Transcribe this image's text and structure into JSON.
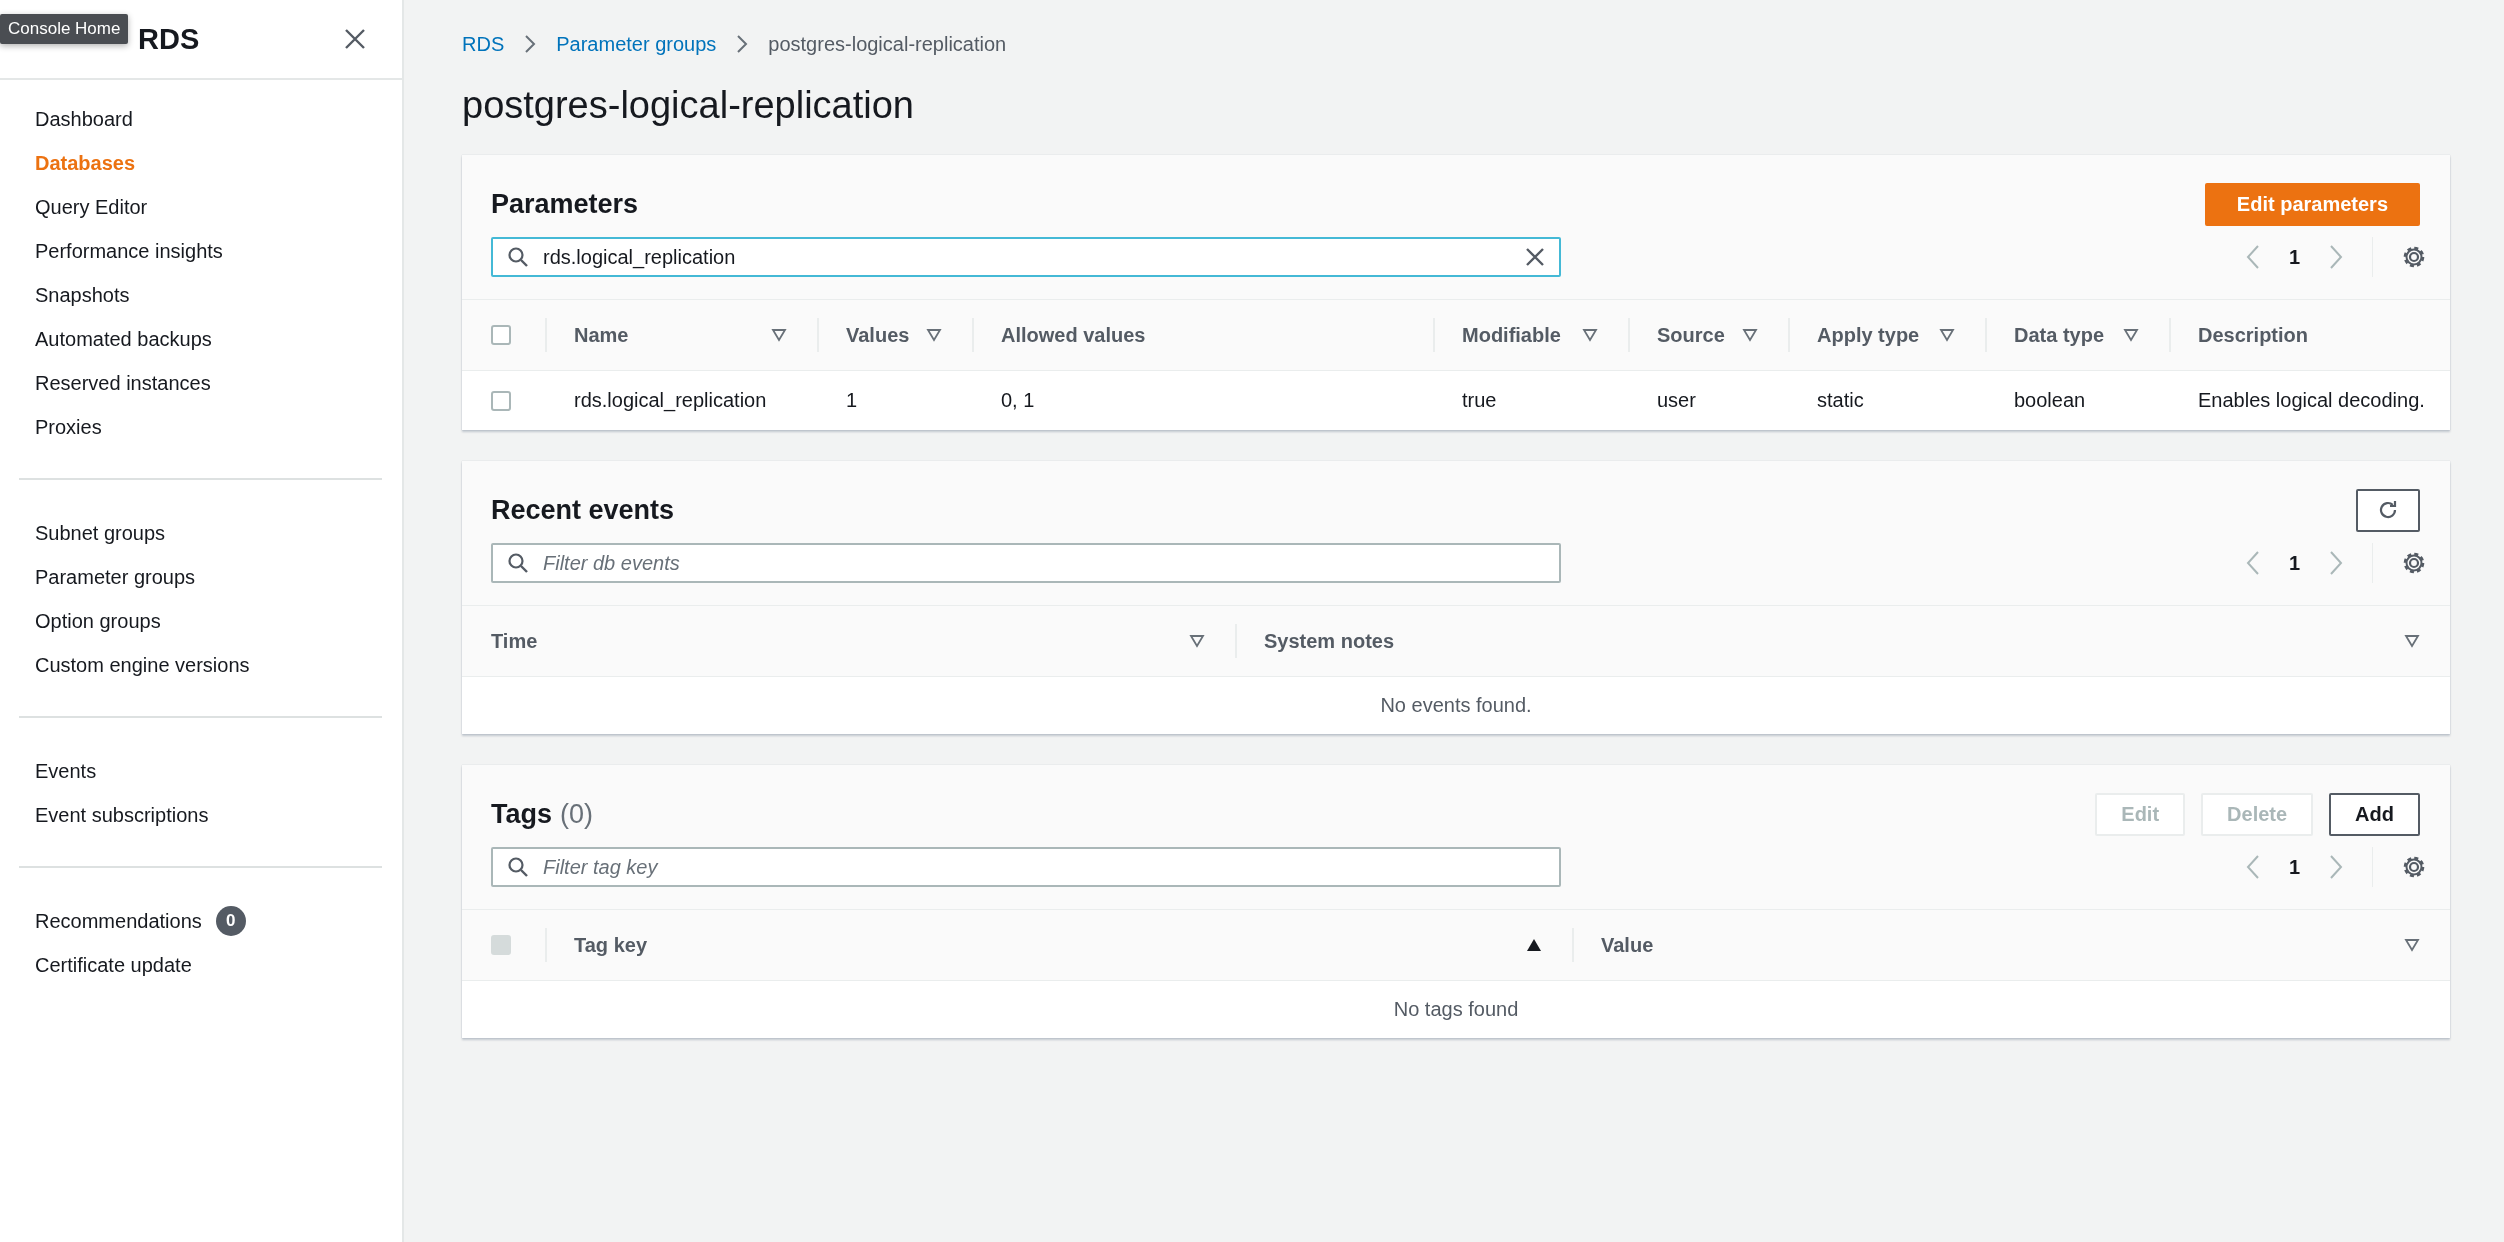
{
  "sidebar": {
    "title": "RDS",
    "tooltip": "Console Home",
    "groups": [
      {
        "items": [
          {
            "label": "Dashboard",
            "selected": false
          },
          {
            "label": "Databases",
            "selected": true
          },
          {
            "label": "Query Editor",
            "selected": false
          },
          {
            "label": "Performance insights",
            "selected": false
          },
          {
            "label": "Snapshots",
            "selected": false
          },
          {
            "label": "Automated backups",
            "selected": false
          },
          {
            "label": "Reserved instances",
            "selected": false
          },
          {
            "label": "Proxies",
            "selected": false
          }
        ]
      },
      {
        "items": [
          {
            "label": "Subnet groups",
            "selected": false
          },
          {
            "label": "Parameter groups",
            "selected": false
          },
          {
            "label": "Option groups",
            "selected": false
          },
          {
            "label": "Custom engine versions",
            "selected": false
          }
        ]
      },
      {
        "items": [
          {
            "label": "Events",
            "selected": false
          },
          {
            "label": "Event subscriptions",
            "selected": false
          }
        ]
      },
      {
        "items": [
          {
            "label": "Recommendations",
            "selected": false,
            "badge": "0"
          },
          {
            "label": "Certificate update",
            "selected": false
          }
        ]
      }
    ]
  },
  "breadcrumbs": [
    {
      "label": "RDS",
      "link": true
    },
    {
      "label": "Parameter groups",
      "link": true
    },
    {
      "label": "postgres-logical-replication",
      "link": false
    }
  ],
  "title": "postgres-logical-replication",
  "panels": [
    {
      "title": "Parameters",
      "primary_button": "Edit parameters",
      "search": {
        "value": "rds.logical_replication"
      },
      "page": "1",
      "header_checkbox": {
        "checked": false,
        "disabled": false
      },
      "columns": [
        {
          "label": "Name",
          "sortable": true,
          "sorted": false
        },
        {
          "label": "Values",
          "sortable": true,
          "sorted": false
        },
        {
          "label": "Allowed values",
          "sortable": false,
          "sorted": false
        },
        {
          "label": "Modifiable",
          "sortable": true,
          "sorted": false
        },
        {
          "label": "Source",
          "sortable": true,
          "sorted": false
        },
        {
          "label": "Apply type",
          "sortable": true,
          "sorted": false
        },
        {
          "label": "Data type",
          "sortable": true,
          "sorted": false
        },
        {
          "label": "Description",
          "sortable": false,
          "sorted": false
        }
      ],
      "rows": [
        {
          "checked": false,
          "cells": [
            "rds.logical_replication",
            "1",
            "0, 1",
            "true",
            "user",
            "static",
            "boolean",
            "Enables logical decoding."
          ]
        }
      ]
    },
    {
      "title": "Recent events",
      "refresh": true,
      "search": {
        "placeholder": "Filter db events"
      },
      "page": "1",
      "columns": [
        {
          "label": "Time",
          "sortable": true,
          "sorted": false
        },
        {
          "label": "System notes",
          "sortable": true,
          "sorted": false
        }
      ],
      "empty": "No events found."
    },
    {
      "title": "Tags",
      "count": "(0)",
      "buttons": [
        {
          "label": "Edit",
          "disabled": true
        },
        {
          "label": "Delete",
          "disabled": true
        },
        {
          "label": "Add",
          "disabled": false
        }
      ],
      "search": {
        "placeholder": "Filter tag key"
      },
      "page": "1",
      "header_checkbox": {
        "checked": false,
        "disabled": true
      },
      "columns": [
        {
          "label": "Tag key",
          "sortable": true,
          "sorted": true
        },
        {
          "label": "Value",
          "sortable": true,
          "sorted": false
        }
      ],
      "empty": "No tags found"
    }
  ]
}
